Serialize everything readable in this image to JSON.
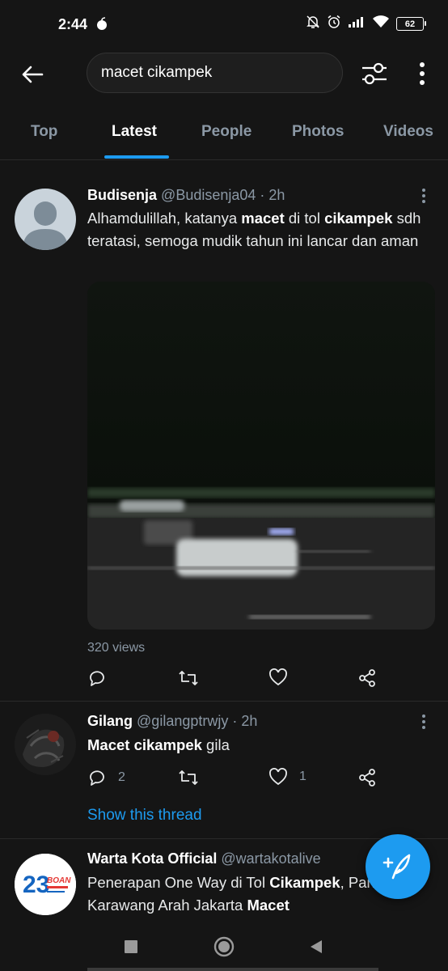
{
  "status_bar": {
    "time": "2:44",
    "battery": "62"
  },
  "search": {
    "query": "macet cikampek"
  },
  "tabs": [
    {
      "label": "Top"
    },
    {
      "label": "Latest"
    },
    {
      "label": "People"
    },
    {
      "label": "Photos"
    },
    {
      "label": "Videos"
    }
  ],
  "active_tab": "Latest",
  "tweets": [
    {
      "name": "Budisenja",
      "handle": "@Budisenja04",
      "time": "· 2h",
      "text": [
        {
          "t": "Alhamdulillah, katanya "
        },
        {
          "t": "macet",
          "bold": true
        },
        {
          "t": " di tol "
        },
        {
          "t": "cikampek",
          "bold": true
        },
        {
          "t": " sdh teratasi, semoga mudik tahun ini lancar dan aman"
        }
      ],
      "views": "320 views",
      "reply_count": "",
      "like_count": ""
    },
    {
      "name": "Gilang",
      "handle": "@gilangptrwjy",
      "time": "· 2h",
      "text": [
        {
          "t": "Macet cikampek",
          "bold": true
        },
        {
          "t": " gila"
        }
      ],
      "reply_count": "2",
      "like_count": "1",
      "show_thread": "Show this thread"
    },
    {
      "name": "Warta Kota Official",
      "handle": "@wartakotalive",
      "time": "",
      "text": [
        {
          "t": "Penerapan One Way di Tol "
        },
        {
          "t": "Cikampek",
          "bold": true
        },
        {
          "t": ", Pantura Karawang Arah Jakarta "
        },
        {
          "t": "Macet",
          "bold": true
        }
      ],
      "avatar_text": {
        "big": "23",
        "sub": "BOAN"
      }
    }
  ],
  "colors": {
    "accent": "#1d9bf0",
    "background": "#151515",
    "muted": "#8b98a5"
  }
}
